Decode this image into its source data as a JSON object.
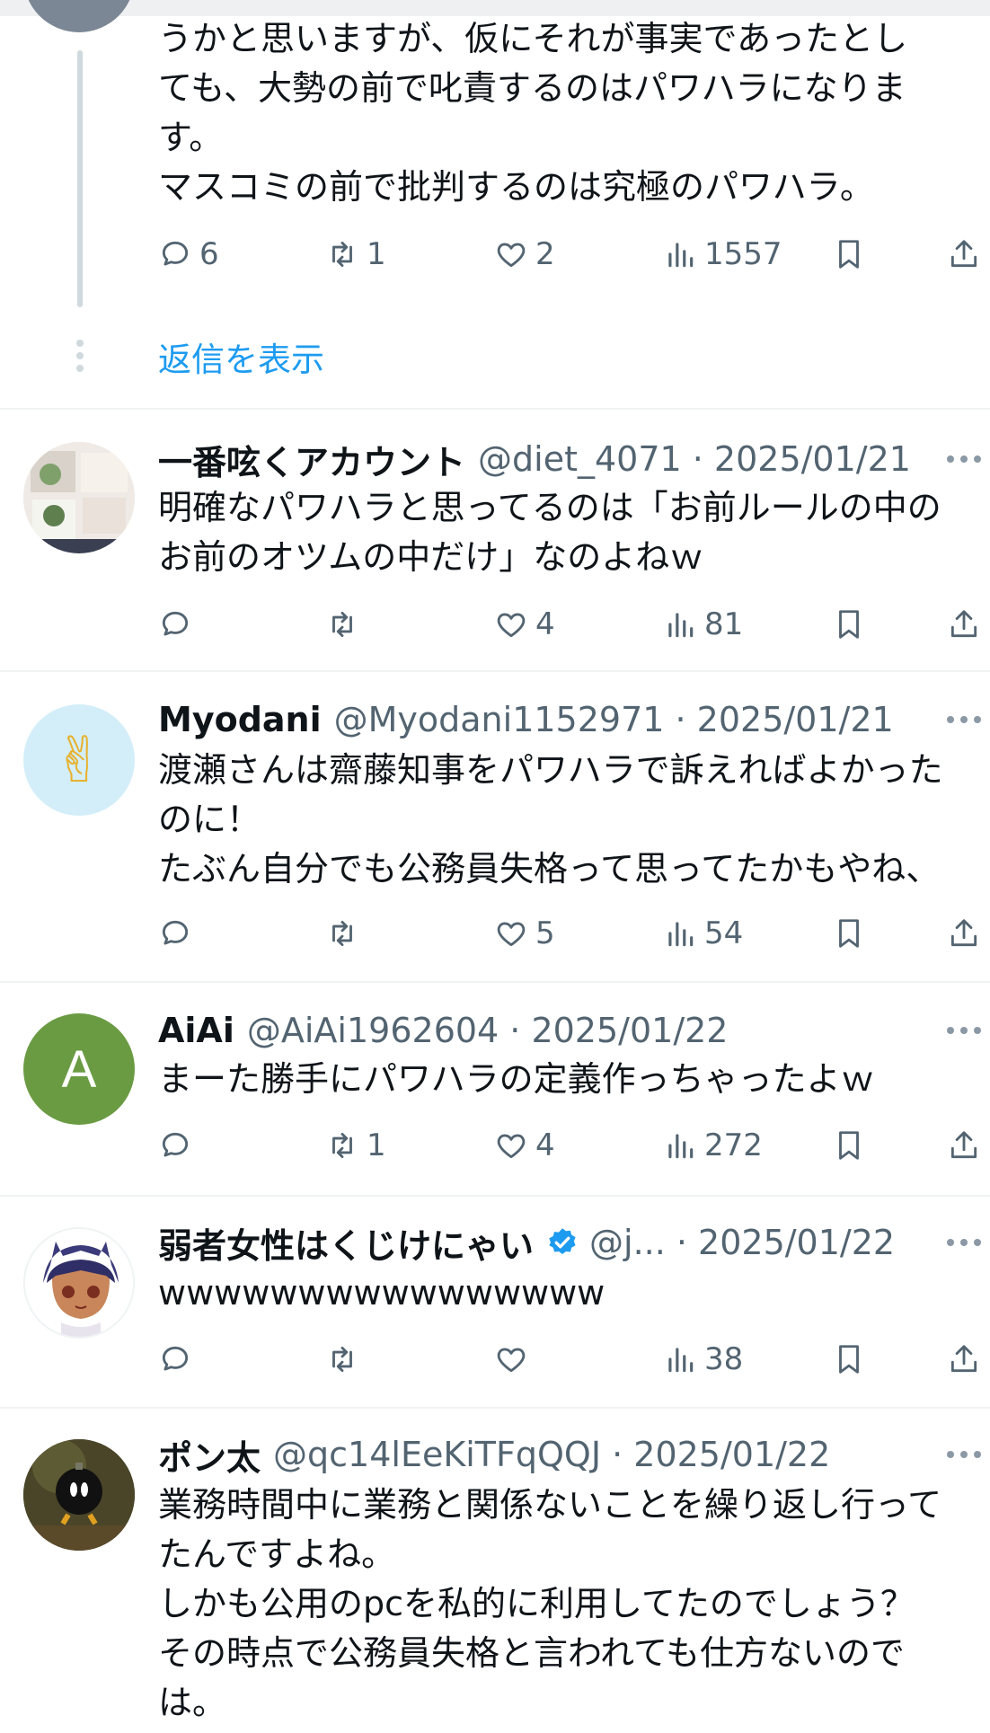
{
  "thread_top": {
    "text": "うかと思いますが、仮にそれが事実であったとし\nても、大勢の前で叱責するのはパワハラになりま\nす。\nマスコミの前で批判するのは究極のパワハラ。",
    "replies": "6",
    "retweets": "1",
    "likes": "2",
    "views": "1557",
    "show_replies": "返信を表示"
  },
  "tweets": [
    {
      "name": "一番呟くアカウント",
      "handle": "@diet_4071 · 2025/01/21",
      "text": "明確なパワハラと思ってるのは「お前ルールの中の\nお前のオツムの中だけ」なのよねｗ",
      "replies": "",
      "retweets": "",
      "likes": "4",
      "views": "81"
    },
    {
      "name": "Myodani",
      "handle": "@Myodani1152971 · 2025/01/21",
      "text": "渡瀬さんは齋藤知事をパワハラで訴えればよかった\nのに！\nたぶん自分でも公務員失格って思ってたかもやね、",
      "replies": "",
      "retweets": "",
      "likes": "5",
      "views": "54",
      "avatar_glyph": "✌"
    },
    {
      "name": "AiAi",
      "handle": "@AiAi1962604 · 2025/01/22",
      "text": "まーた勝手にパワハラの定義作っちゃったよｗ",
      "replies": "",
      "retweets": "1",
      "likes": "4",
      "views": "272",
      "avatar_letter": "A"
    },
    {
      "name": "弱者女性はくじけにゃい",
      "handle": "@j... · 2025/01/22",
      "text": "wwwwwwwwwwwwwwww",
      "replies": "",
      "retweets": "",
      "likes": "",
      "views": "38"
    },
    {
      "name": "ポン太",
      "handle": "@qc14lEeKiTFqQQJ · 2025/01/22",
      "text": "業務時間中に業務と関係ないことを繰り返し行って\nたんですよね。\nしかも公用のpcを私的に利用してたのでしょう？\nその時点で公務員失格と言われても仕方ないので\nは。"
    }
  ],
  "colors": {
    "text": "#0f1419",
    "secondary": "#536471",
    "link": "#1d9bf0",
    "divider": "#eff3f4",
    "avatar_aiai": "#6a9b43",
    "avatar_myodani": "#d3eef9"
  }
}
